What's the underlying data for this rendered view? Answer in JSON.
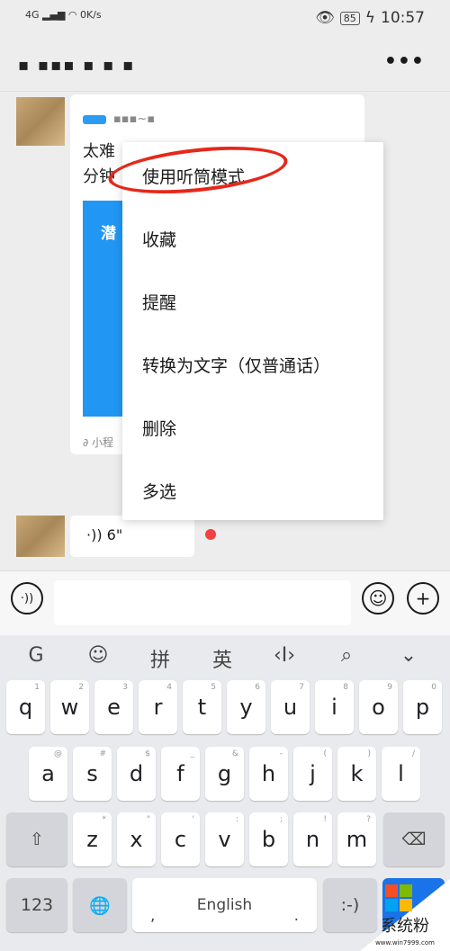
{
  "status": {
    "signal": "4G",
    "speed_value": "0",
    "speed_unit": "K/s",
    "battery": "85",
    "time": "10:57"
  },
  "header": {
    "more": "•••"
  },
  "card": {
    "text_line1": "太难",
    "text_line2": "分钟",
    "image_text": "潜",
    "footer": "小程"
  },
  "menu": {
    "items": [
      "使用听筒模式",
      "收藏",
      "提醒",
      "转换为文字（仅普通话）",
      "删除",
      "多选"
    ]
  },
  "voice": {
    "duration": "6\""
  },
  "keyboard": {
    "toolbar": [
      "G",
      "☺",
      "拼",
      "英",
      "‹I›",
      "⌕",
      "⌄"
    ],
    "row1": [
      [
        "q",
        "1"
      ],
      [
        "w",
        "2"
      ],
      [
        "e",
        "3"
      ],
      [
        "r",
        "4"
      ],
      [
        "t",
        "5"
      ],
      [
        "y",
        "6"
      ],
      [
        "u",
        "7"
      ],
      [
        "i",
        "8"
      ],
      [
        "o",
        "9"
      ],
      [
        "p",
        "0"
      ]
    ],
    "row2": [
      [
        "a",
        "@"
      ],
      [
        "s",
        "#"
      ],
      [
        "d",
        "$"
      ],
      [
        "f",
        "_"
      ],
      [
        "g",
        "&"
      ],
      [
        "h",
        "-"
      ],
      [
        "j",
        "("
      ],
      [
        "k",
        ")"
      ],
      [
        "l",
        "/"
      ]
    ],
    "row3": [
      [
        "z",
        "*"
      ],
      [
        "x",
        "\""
      ],
      [
        "c",
        "'"
      ],
      [
        "v",
        ":"
      ],
      [
        "b",
        ";"
      ],
      [
        "n",
        "!"
      ],
      [
        "m",
        "?"
      ]
    ],
    "num": "123",
    "space": "English",
    "comma": ",",
    "period": ".",
    "emoticon": ":-)"
  },
  "watermark": {
    "text": "系统粉",
    "url": "www.win7999.com",
    "colors": [
      "#f25022",
      "#7fba00",
      "#00a4ef",
      "#ffb900"
    ]
  }
}
